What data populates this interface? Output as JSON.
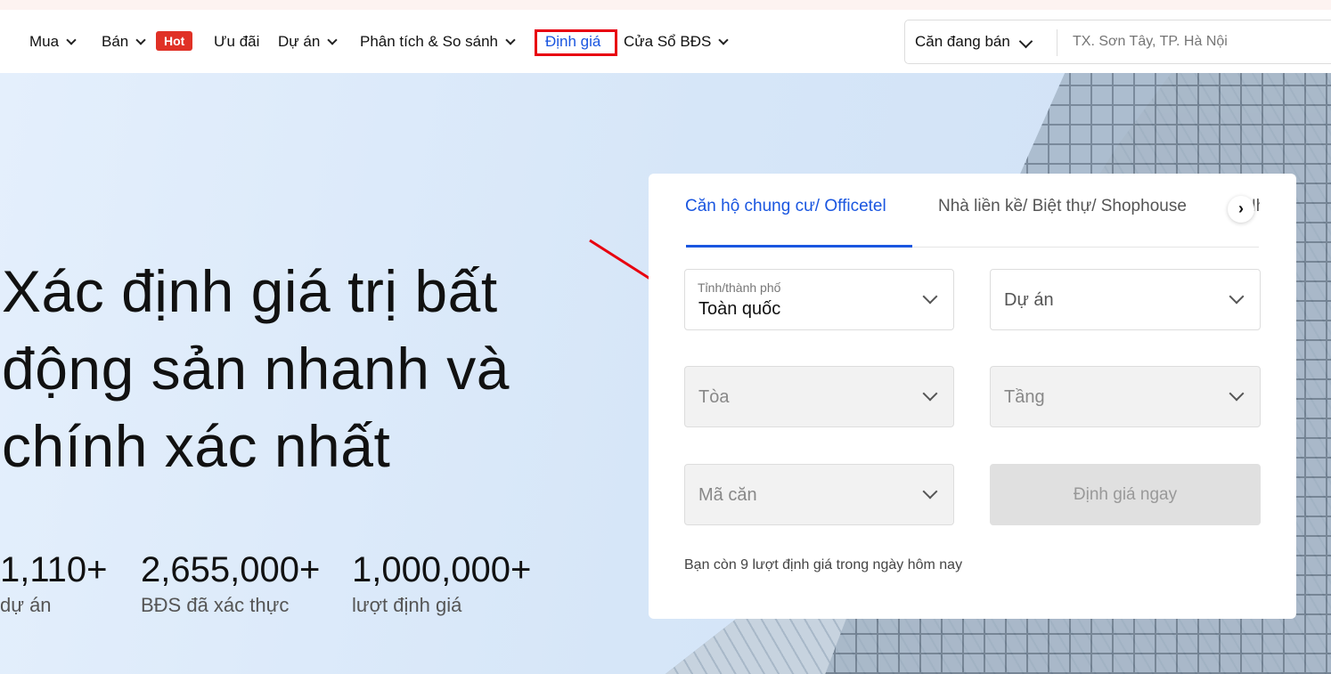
{
  "nav": {
    "items": [
      {
        "label": "Mua",
        "dropdown": true
      },
      {
        "label": "Bán",
        "dropdown": true
      },
      {
        "label": "Ưu đãi"
      },
      {
        "label": "Dự án",
        "dropdown": true
      },
      {
        "label": "Phân tích & So sánh",
        "dropdown": true
      },
      {
        "label": "Định giá",
        "active": true
      },
      {
        "label": "Cửa Sổ BĐS",
        "dropdown": true
      }
    ],
    "hot_badge": "Hot",
    "accent": "#1a56e0"
  },
  "search": {
    "type": "Căn đang bán",
    "placeholder": "TX. Sơn Tây, TP. Hà Nội"
  },
  "hero": {
    "headline_lines": [
      "Xác định giá trị bất",
      "động sản nhanh và",
      "chính xác nhất"
    ],
    "stats": [
      {
        "value": "1,110+",
        "label": "dự án"
      },
      {
        "value": "2,655,000+",
        "label": "BĐS đã xác thực"
      },
      {
        "value": "1,000,000+",
        "label": "lượt định giá"
      }
    ]
  },
  "card": {
    "tabs": [
      "Căn hộ chung cư/ Officetel",
      "Nhà liền kề/ Biệt thự/ Shophouse",
      "Nh"
    ],
    "fields": {
      "province_label": "Tỉnh/thành phố",
      "province_value": "Toàn quốc",
      "project": "Dự án",
      "building": "Tòa",
      "floor": "Tầng",
      "unit": "Mã căn"
    },
    "submit": "Định giá ngay",
    "note": "Bạn còn 9 lượt định giá trong ngày hôm nay"
  }
}
